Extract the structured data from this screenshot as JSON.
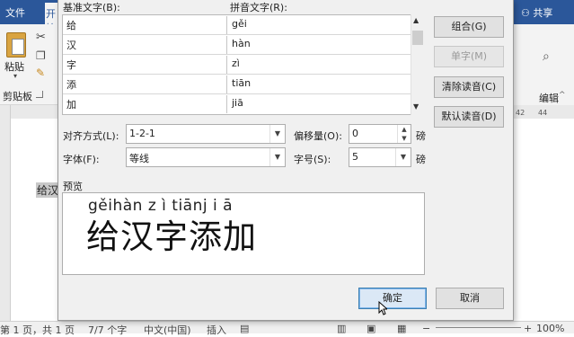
{
  "word": {
    "tab_file": "文件",
    "tab_home": "开始",
    "share": "共享",
    "paste_label": "粘贴",
    "clipboard_group": "剪贴板",
    "edit_label": "编辑",
    "ruler_right": [
      "42",
      "44"
    ],
    "doc_text": "给汉",
    "status": {
      "page": "第 1 页，共 1 页",
      "words": "7/7 个字",
      "language": "中文(中国)",
      "insert": "插入",
      "zoom": "100%"
    }
  },
  "dialog": {
    "col_base": "基准文字(B):",
    "col_pinyin": "拼音文字(R):",
    "rows": [
      {
        "base": "给",
        "pinyin": "gěi"
      },
      {
        "base": "汉",
        "pinyin": "hàn"
      },
      {
        "base": "字",
        "pinyin": "zì"
      },
      {
        "base": "添",
        "pinyin": "tiān"
      },
      {
        "base": "加",
        "pinyin": "jiā"
      }
    ],
    "buttons": {
      "group": "组合(G)",
      "single": "单字(M)",
      "clear": "清除读音(C)",
      "default": "默认读音(D)",
      "ok": "确定",
      "cancel": "取消"
    },
    "align_label": "对齐方式(L):",
    "align_value": "1-2-1",
    "offset_label": "偏移量(O):",
    "offset_value": "0",
    "offset_unit": "磅",
    "font_label": "字体(F):",
    "font_value": "等线",
    "size_label": "字号(S):",
    "size_value": "5",
    "size_unit": "磅",
    "preview_label": "预览",
    "preview_pinyin": "gěihàn z ì tiānj i ā",
    "preview_base": "给汉字添加"
  }
}
